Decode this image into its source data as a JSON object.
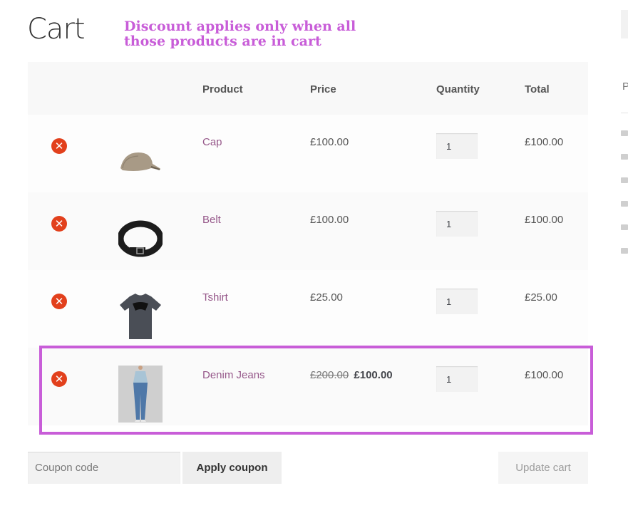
{
  "page": {
    "title": "Cart"
  },
  "annotation": {
    "line1": "Discount applies only when all",
    "line2": "those products are in cart"
  },
  "table": {
    "headers": [
      "Product",
      "Price",
      "Quantity",
      "Total"
    ],
    "rows": [
      {
        "name": "Cap",
        "price": "£100.00",
        "quantity": "1",
        "total": "£100.00",
        "image": "cap-image"
      },
      {
        "name": "Belt",
        "price": "£100.00",
        "quantity": "1",
        "total": "£100.00",
        "image": "belt-image"
      },
      {
        "name": "Tshirt",
        "price": "£25.00",
        "quantity": "1",
        "total": "£25.00",
        "image": "tshirt-image"
      },
      {
        "name": "Denim Jeans",
        "price_old": "£200.00",
        "price": "£100.00",
        "quantity": "1",
        "total": "£100.00",
        "image": "jeans-image"
      }
    ]
  },
  "coupon": {
    "placeholder": "Coupon code",
    "apply_label": "Apply coupon"
  },
  "update_label": "Update cart",
  "sidebar": {
    "letter": "P"
  },
  "colors": {
    "link": "#96588a",
    "remove": "#e2401c",
    "highlight": "#c85dd8"
  },
  "icons": {
    "remove": "remove-x-icon",
    "folder": "folder-icon"
  }
}
